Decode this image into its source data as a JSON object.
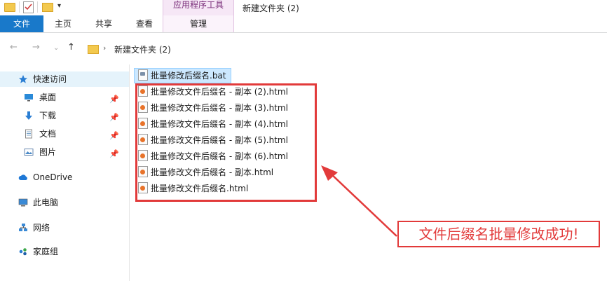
{
  "titlebar": {
    "context_tab": "应用程序工具",
    "window_title": "新建文件夹 (2)"
  },
  "ribbon": {
    "tabs": [
      {
        "label": "文件"
      },
      {
        "label": "主页"
      },
      {
        "label": "共享"
      },
      {
        "label": "查看"
      },
      {
        "label": "管理"
      }
    ]
  },
  "address": {
    "path": "新建文件夹 (2)"
  },
  "sidebar": {
    "items": [
      {
        "label": "快速访问",
        "icon": "star-icon"
      },
      {
        "label": "桌面",
        "icon": "desktop-icon"
      },
      {
        "label": "下载",
        "icon": "download-icon"
      },
      {
        "label": "文档",
        "icon": "document-icon"
      },
      {
        "label": "图片",
        "icon": "pictures-icon"
      },
      {
        "label": "OneDrive",
        "icon": "cloud-icon"
      },
      {
        "label": "此电脑",
        "icon": "computer-icon"
      },
      {
        "label": "网络",
        "icon": "network-icon"
      },
      {
        "label": "家庭组",
        "icon": "homegroup-icon"
      }
    ]
  },
  "files": [
    {
      "name": "批量修改后缀名.bat",
      "type": "bat"
    },
    {
      "name": "批量修改文件后缀名 - 副本 (2).html",
      "type": "html"
    },
    {
      "name": "批量修改文件后缀名 - 副本 (3).html",
      "type": "html"
    },
    {
      "name": "批量修改文件后缀名 - 副本 (4).html",
      "type": "html"
    },
    {
      "name": "批量修改文件后缀名 - 副本 (5).html",
      "type": "html"
    },
    {
      "name": "批量修改文件后缀名 - 副本 (6).html",
      "type": "html"
    },
    {
      "name": "批量修改文件后缀名 - 副本.html",
      "type": "html"
    },
    {
      "name": "批量修改文件后缀名.html",
      "type": "html"
    }
  ],
  "annotation": {
    "callout": "文件后缀名批量修改成功!",
    "color": "#e23a3a"
  },
  "colors": {
    "accent": "#1979ca",
    "selection": "#cce8ff",
    "context_tab": "#7a2e7a"
  }
}
